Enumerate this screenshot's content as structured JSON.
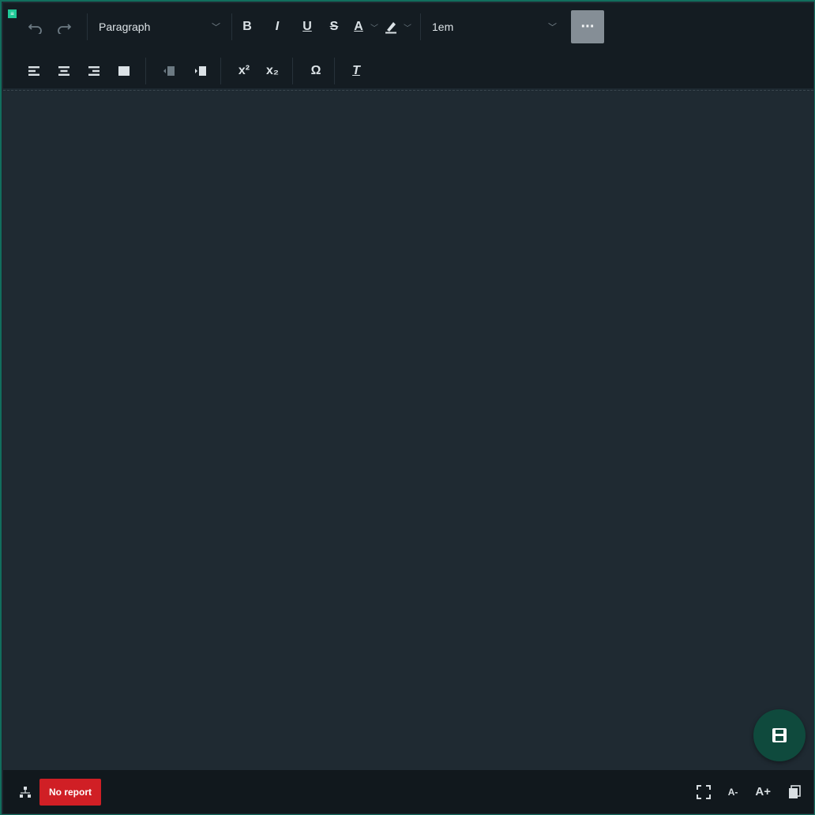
{
  "toolbar": {
    "undo_icon": "undo-icon",
    "redo_icon": "redo-icon",
    "block_format": "Paragraph",
    "bold_label": "B",
    "italic_label": "I",
    "underline_label": "U",
    "strike_label": "S",
    "text_color_label": "A",
    "font_size": "1em",
    "more_label": "···",
    "superscript_label": "x²",
    "subscript_label": "x₂",
    "special_char_label": "Ω",
    "clear_format_label": "T"
  },
  "status": {
    "report_badge": "No report",
    "font_decrease": "A-",
    "font_increase": "A+"
  },
  "colors": {
    "accent": "#126e5e",
    "fab": "#0f4a3d",
    "badge": "#d01f25"
  }
}
